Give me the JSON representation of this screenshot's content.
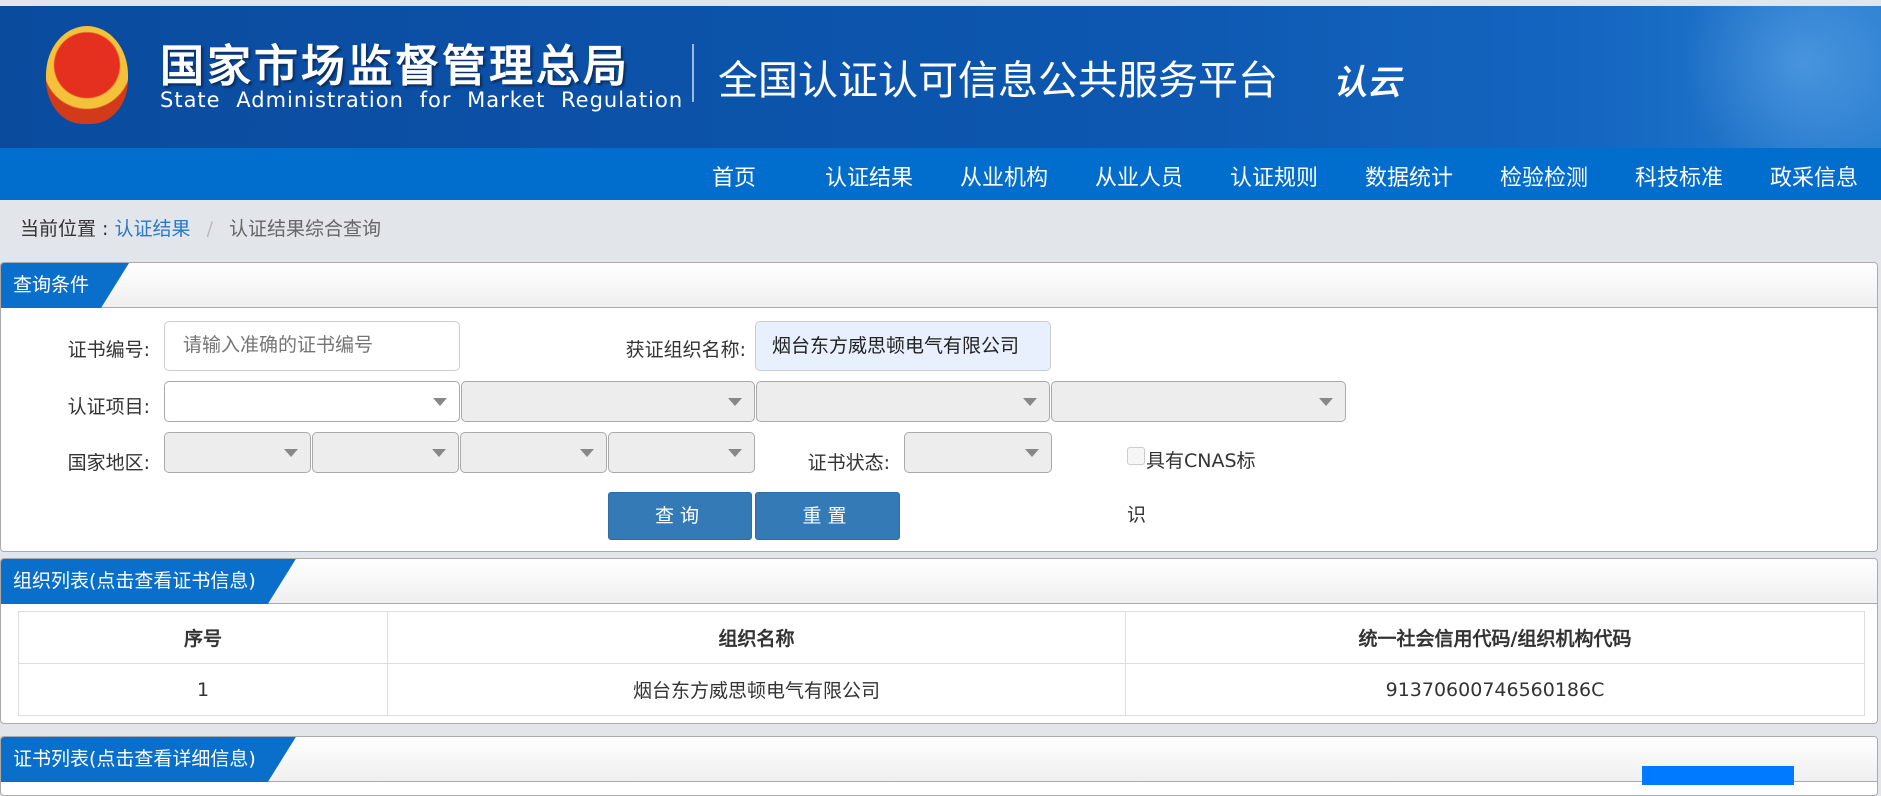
{
  "header": {
    "agency_cn": "国家市场监督管理总局",
    "agency_en": "State Administration  for  Market Regulation",
    "platform": "全国认证认可信息公共服务平台",
    "logo_text": "认云"
  },
  "nav": [
    "首页",
    "认证结果",
    "从业机构",
    "从业人员",
    "认证规则",
    "数据统计",
    "检验检测",
    "科技标准",
    "政采信息"
  ],
  "breadcrumb": {
    "prefix": "当前位置 :",
    "link": "认证结果",
    "sep": "/",
    "current": "认证结果综合查询"
  },
  "query": {
    "title": "查询条件",
    "cert_no_label": "证书编号:",
    "cert_no_placeholder": "请输入准确的证书编号",
    "org_label": "获证组织名称:",
    "org_value": "烟台东方威思顿电气有限公司",
    "project_label": "认证项目:",
    "region_label": "国家地区:",
    "status_label": "证书状态:",
    "cnas_label_1": "具有CNAS标",
    "cnas_label_2": "识",
    "search": "查询",
    "reset": "重置"
  },
  "org_list": {
    "title": "组织列表(点击查看证书信息)",
    "columns": [
      "序号",
      "组织名称",
      "统一社会信用代码/组织机构代码"
    ],
    "rows": [
      [
        "1",
        "烟台东方威思顿电气有限公司",
        "91370600746560186C"
      ]
    ]
  },
  "cert_list": {
    "title": "证书列表(点击查看详细信息)"
  }
}
